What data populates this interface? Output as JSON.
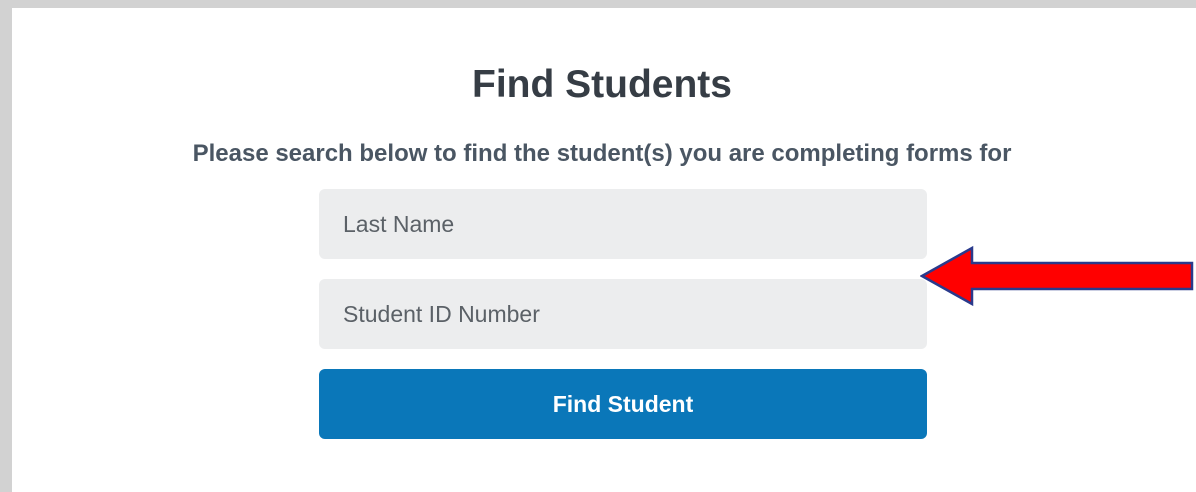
{
  "page": {
    "title": "Find Students",
    "subtitle": "Please search below to find the student(s) you are completing forms for"
  },
  "form": {
    "last_name": {
      "placeholder": "Last Name",
      "value": ""
    },
    "student_id": {
      "placeholder": "Student ID Number",
      "value": ""
    },
    "submit_label": "Find Student"
  },
  "annotation": {
    "icon": "red-arrow-left-icon",
    "color": "#ff0000",
    "outline_color": "#2a3a8c"
  },
  "colors": {
    "button": "#0a77b9",
    "field_bg": "#ecedee",
    "title": "#363d45",
    "frame": "#d2d2d2"
  }
}
